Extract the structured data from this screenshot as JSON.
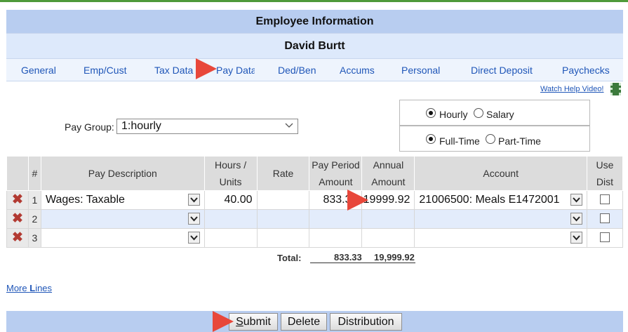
{
  "header": {
    "title": "Employee Information",
    "employee_name": "David Burtt"
  },
  "tabs": [
    {
      "label": "General"
    },
    {
      "label": "Emp/Cust"
    },
    {
      "label": "Tax Data"
    },
    {
      "label": "Pay Data",
      "active": true
    },
    {
      "label": "Ded/Ben"
    },
    {
      "label": "Accums"
    },
    {
      "label": "Personal"
    },
    {
      "label": "Direct Deposit"
    },
    {
      "label": "Paychecks"
    }
  ],
  "help": {
    "watch_video": "Watch Help Video!"
  },
  "pay_group": {
    "label": "Pay Group:",
    "value": "1:hourly"
  },
  "pay_type": {
    "options": [
      {
        "label": "Hourly",
        "selected": true
      },
      {
        "label": "Salary",
        "selected": false
      }
    ]
  },
  "employment": {
    "options": [
      {
        "label": "Full-Time",
        "selected": true
      },
      {
        "label": "Part-Time",
        "selected": false
      }
    ]
  },
  "table": {
    "headers": {
      "num": "#",
      "pay_description": "Pay Description",
      "hours_1": "Hours /",
      "hours_2": "Units",
      "rate": "Rate",
      "pay_period_1": "Pay Period",
      "pay_period_2": "Amount",
      "annual_1": "Annual",
      "annual_2": "Amount",
      "account": "Account",
      "use_dist_1": "Use",
      "use_dist_2": "Dist"
    },
    "rows": [
      {
        "num": "1",
        "pay_description": "Wages: Taxable",
        "hours": "40.00",
        "rate": "",
        "pay_period_amount": "833.33",
        "annual_amount": "19999.92",
        "account": "21006500: Meals E1472001"
      },
      {
        "num": "2",
        "pay_description": "",
        "hours": "",
        "rate": "",
        "pay_period_amount": "",
        "annual_amount": "",
        "account": ""
      },
      {
        "num": "3",
        "pay_description": "",
        "hours": "",
        "rate": "",
        "pay_period_amount": "",
        "annual_amount": "",
        "account": ""
      }
    ],
    "total_label": "Total:",
    "total_pay_period": "833.33",
    "total_annual": "19,999.92"
  },
  "more_lines": {
    "prefix": "More ",
    "accel": "L",
    "suffix": "ines"
  },
  "buttons": {
    "submit_accel": "S",
    "submit_rest": "ubmit",
    "delete": "Delete",
    "distribution": "Distribution"
  },
  "colors": {
    "header": "#b8cdf0",
    "arrow": "#e8473a",
    "link": "#1f56b8"
  }
}
